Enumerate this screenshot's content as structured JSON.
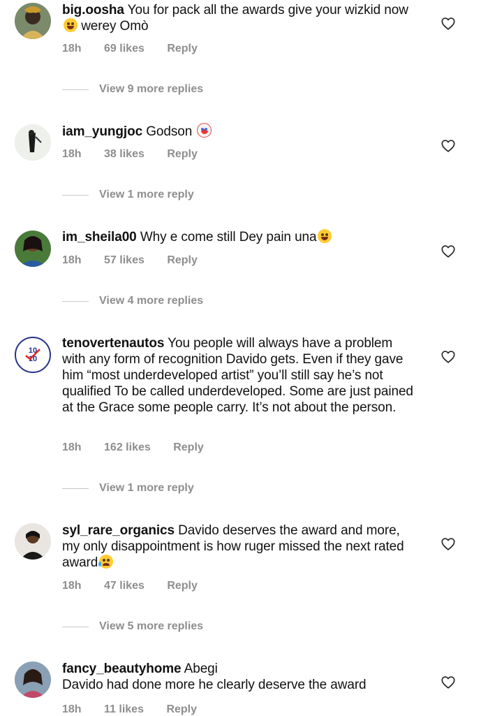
{
  "comments": [
    {
      "username": "big.oosha",
      "text_a": "You for pack all the awards give your wizkid now",
      "text_b": "werey Omò",
      "emoji": "laughing-tears",
      "time": "18h",
      "likes": "69 likes",
      "reply": "Reply",
      "view_more": "View 9 more replies"
    },
    {
      "username": "iam_yungjoc",
      "text_a": "Godson",
      "emoji": "clown-face",
      "time": "18h",
      "likes": "38 likes",
      "reply": "Reply",
      "view_more": "View 1 more reply"
    },
    {
      "username": "im_sheila00",
      "text_a": "Why e come still Dey pain una",
      "emoji": "laughing-tears",
      "time": "18h",
      "likes": "57 likes",
      "reply": "Reply",
      "view_more": "View 4 more replies"
    },
    {
      "username": "tenovertenautos",
      "text_a": "You people will always have a problem with any form of recognition Davido gets. Even if they gave him “most underdeveloped artist” you’ll still say he’s not qualified To be called underdeveloped. Some are just pained at the Grace some people carry. It’s not about the person.",
      "time": "18h",
      "likes": "162 likes",
      "reply": "Reply",
      "view_more": "View 1 more reply",
      "avatar_logo_text": "10/10"
    },
    {
      "username": "syl_rare_organics",
      "text_a": "Davido deserves the award and more, my only disappointment is how ruger missed the next rated award",
      "emoji": "crying-face",
      "time": "18h",
      "likes": "47 likes",
      "reply": "Reply",
      "view_more": "View 5 more replies"
    },
    {
      "username": "fancy_beautyhome",
      "text_a": "Abegi",
      "text_b": "Davido had done more he clearly deserve the award",
      "time": "18h",
      "likes": "11 likes",
      "reply": "Reply"
    }
  ],
  "icons": {
    "like": "heart-outline-icon"
  },
  "colors": {
    "meta_gray": "#8e8e8e",
    "text": "#111111",
    "divider": "#c7c7c7"
  }
}
